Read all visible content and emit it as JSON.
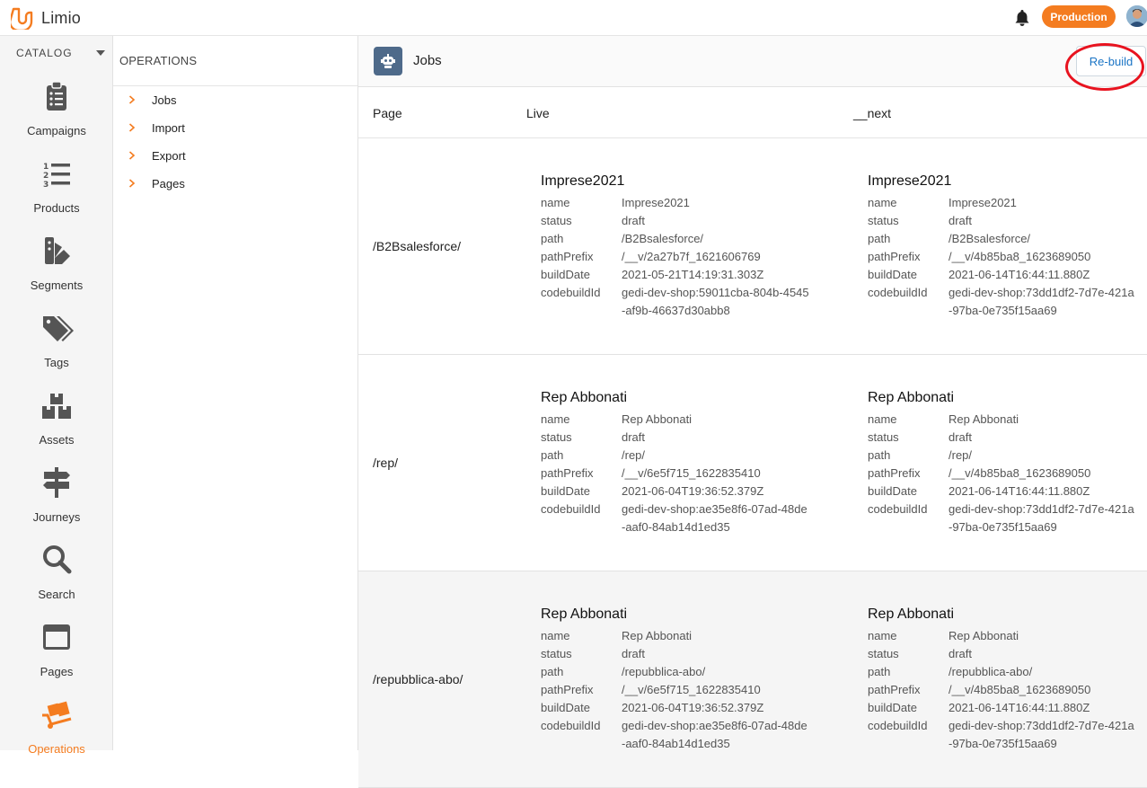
{
  "app": {
    "name": "Limio",
    "environment": "Production"
  },
  "rail": {
    "heading": "CATALOG",
    "items": [
      {
        "label": "Campaigns",
        "icon": "clipboard-icon"
      },
      {
        "label": "Products",
        "icon": "numbered-list-icon"
      },
      {
        "label": "Segments",
        "icon": "segments-icon"
      },
      {
        "label": "Tags",
        "icon": "tags-icon"
      },
      {
        "label": "Assets",
        "icon": "boxes-icon"
      },
      {
        "label": "Journeys",
        "icon": "signpost-icon"
      },
      {
        "label": "Search",
        "icon": "magnifier-icon"
      },
      {
        "label": "Pages",
        "icon": "browser-window-icon"
      },
      {
        "label": "Operations",
        "icon": "hand-truck-icon",
        "active": true
      }
    ]
  },
  "submenu": {
    "heading": "OPERATIONS",
    "items": [
      "Jobs",
      "Import",
      "Export",
      "Pages"
    ]
  },
  "main": {
    "title": "Jobs",
    "rebuild_label": "Re-build",
    "columns": {
      "page": "Page",
      "live": "Live",
      "next": "__next"
    },
    "field_labels": [
      "name",
      "status",
      "path",
      "pathPrefix",
      "buildDate",
      "codebuildId"
    ],
    "rows": [
      {
        "page": "/B2Bsalesforce/",
        "live": {
          "title": "Imprese2021",
          "name": "Imprese2021",
          "status": "draft",
          "path": "/B2Bsalesforce/",
          "pathPrefix": "/__v/2a27b7f_1621606769",
          "buildDate": "2021-05-21T14:19:31.303Z",
          "codebuildId": "gedi-dev-shop:59011cba-804b-4545-af9b-46637d30abb8"
        },
        "next": {
          "title": "Imprese2021",
          "name": "Imprese2021",
          "status": "draft",
          "path": "/B2Bsalesforce/",
          "pathPrefix": "/__v/4b85ba8_1623689050",
          "buildDate": "2021-06-14T16:44:11.880Z",
          "codebuildId": "gedi-dev-shop:73dd1df2-7d7e-421a-97ba-0e735f15aa69"
        }
      },
      {
        "page": "/rep/",
        "live": {
          "title": "Rep Abbonati",
          "name": "Rep Abbonati",
          "status": "draft",
          "path": "/rep/",
          "pathPrefix": "/__v/6e5f715_1622835410",
          "buildDate": "2021-06-04T19:36:52.379Z",
          "codebuildId": "gedi-dev-shop:ae35e8f6-07ad-48de-aaf0-84ab14d1ed35"
        },
        "next": {
          "title": "Rep Abbonati",
          "name": "Rep Abbonati",
          "status": "draft",
          "path": "/rep/",
          "pathPrefix": "/__v/4b85ba8_1623689050",
          "buildDate": "2021-06-14T16:44:11.880Z",
          "codebuildId": "gedi-dev-shop:73dd1df2-7d7e-421a-97ba-0e735f15aa69"
        }
      },
      {
        "page": "/repubblica-abo/",
        "live": {
          "title": "Rep Abbonati",
          "name": "Rep Abbonati",
          "status": "draft",
          "path": "/repubblica-abo/",
          "pathPrefix": "/__v/6e5f715_1622835410",
          "buildDate": "2021-06-04T19:36:52.379Z",
          "codebuildId": "gedi-dev-shop:ae35e8f6-07ad-48de-aaf0-84ab14d1ed35"
        },
        "next": {
          "title": "Rep Abbonati",
          "name": "Rep Abbonati",
          "status": "draft",
          "path": "/repubblica-abo/",
          "pathPrefix": "/__v/4b85ba8_1623689050",
          "buildDate": "2021-06-14T16:44:11.880Z",
          "codebuildId": "gedi-dev-shop:73dd1df2-7d7e-421a-97ba-0e735f15aa69"
        }
      }
    ]
  },
  "colors": {
    "accent": "#f47c20",
    "link": "#1a74c5",
    "highlight": "#e8131f",
    "icon": "#555555"
  }
}
